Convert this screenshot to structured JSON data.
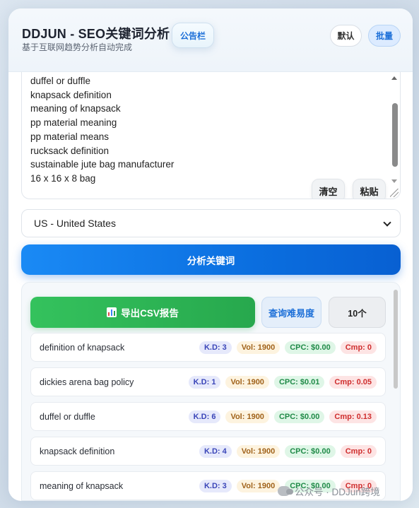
{
  "header": {
    "title": "DDJUN - SEO关键词分析",
    "subtitle": "基于互联网趋势分析自动完成",
    "notice_label": "公告栏",
    "mode_default_label": "默认",
    "mode_batch_label": "批量"
  },
  "keywords_input": {
    "lines": [
      "duffel or duffle",
      "knapsack definition",
      "meaning of knapsack",
      "pp material meaning",
      "pp material means",
      "rucksack definition",
      "sustainable jute bag manufacturer",
      "16 x 16 x 8 bag"
    ],
    "clear_label": "清空",
    "paste_label": "粘贴"
  },
  "country": {
    "selected": "US - United States"
  },
  "analyze_label": "分析关键词",
  "results": {
    "export_label": "导出CSV报告",
    "difficulty_label": "查询难易度",
    "count_label": "10个",
    "rows": [
      {
        "keyword": "definition of knapsack",
        "kd": "K.D: 3",
        "vol": "Vol: 1900",
        "cpc": "CPC: $0.00",
        "cmp": "Cmp: 0"
      },
      {
        "keyword": "dickies arena bag policy",
        "kd": "K.D: 1",
        "vol": "Vol: 1900",
        "cpc": "CPC: $0.01",
        "cmp": "Cmp: 0.05"
      },
      {
        "keyword": "duffel or duffle",
        "kd": "K.D: 6",
        "vol": "Vol: 1900",
        "cpc": "CPC: $0.00",
        "cmp": "Cmp: 0.13"
      },
      {
        "keyword": "knapsack definition",
        "kd": "K.D: 4",
        "vol": "Vol: 1900",
        "cpc": "CPC: $0.00",
        "cmp": "Cmp: 0"
      },
      {
        "keyword": "meaning of knapsack",
        "kd": "K.D: 3",
        "vol": "Vol: 1900",
        "cpc": "CPC: $0.00",
        "cmp": "Cmp: 0"
      }
    ]
  },
  "watermark": "公众号 · DDJun跨境",
  "colors": {
    "accent": "#1a8af5",
    "export_green": "#34c25d",
    "kd": "#3a45b8",
    "vol": "#a0621a",
    "cpc": "#1f8a47",
    "cmp": "#cf2e2e"
  }
}
